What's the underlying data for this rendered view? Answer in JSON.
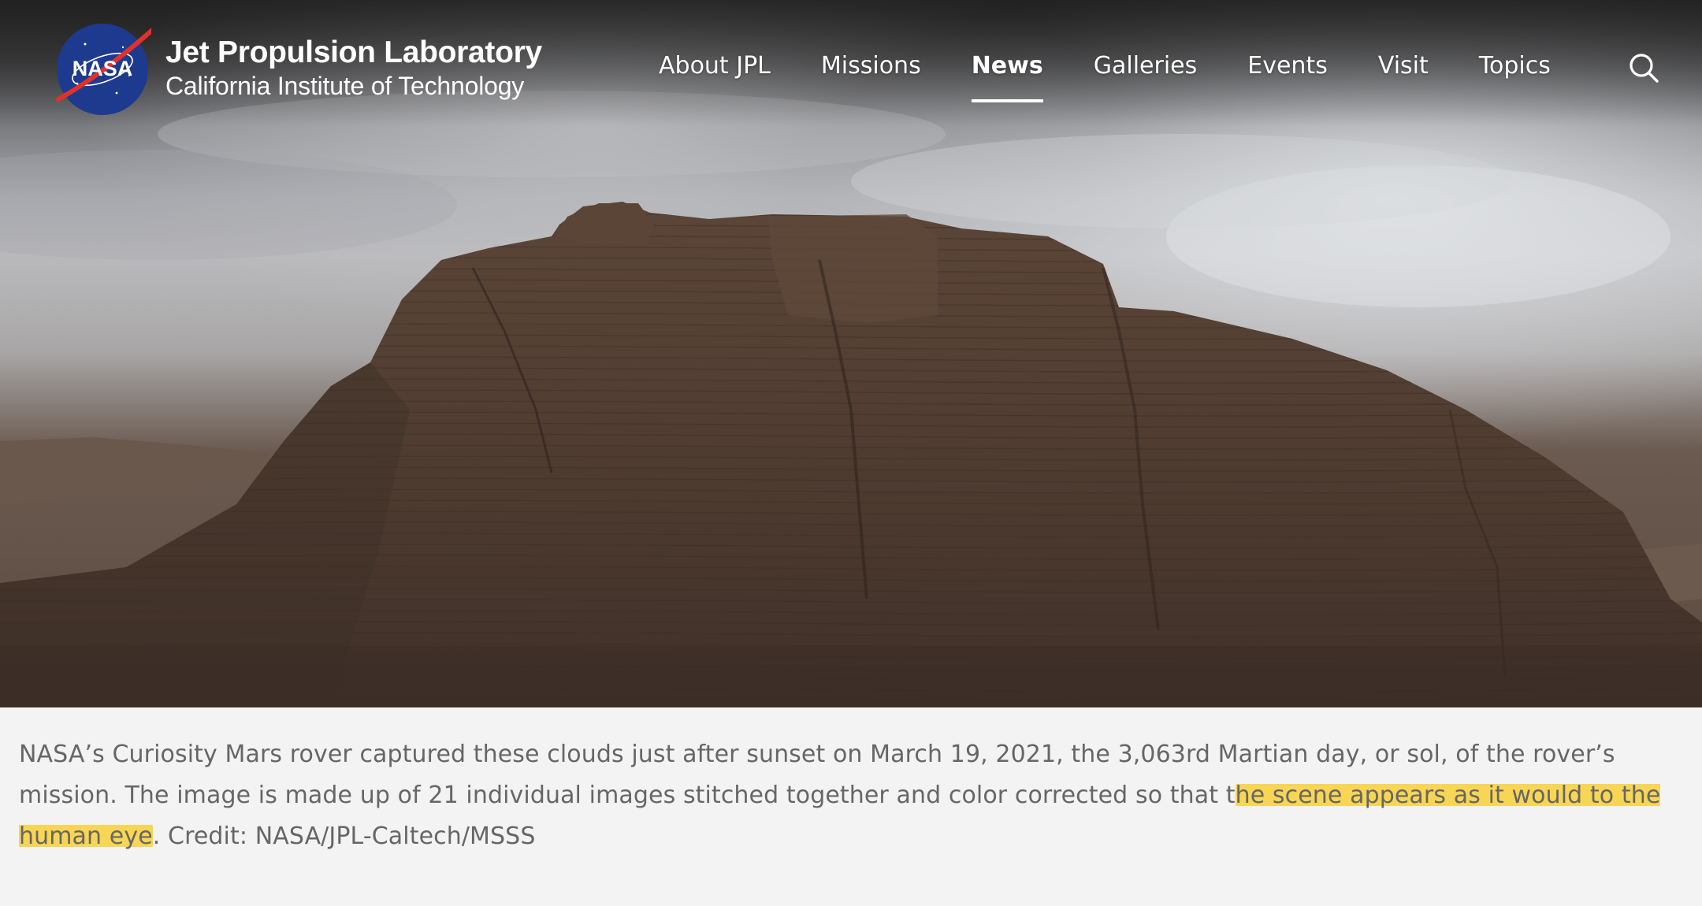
{
  "header": {
    "logo_text": "NASA",
    "brand_title": "Jet Propulsion Laboratory",
    "brand_subtitle": "California Institute of Technology",
    "nav": [
      {
        "label": "About JPL"
      },
      {
        "label": "Missions"
      },
      {
        "label": "News",
        "active": true
      },
      {
        "label": "Galleries"
      },
      {
        "label": "Events"
      },
      {
        "label": "Visit"
      },
      {
        "label": "Topics"
      }
    ],
    "search_icon": "search-icon"
  },
  "caption": {
    "text_before": "NASA’s Curiosity Mars rover captured these clouds just after sunset on March 19, 2021, the 3,063rd Martian day, or sol, of the rover’s mission. The image is made up of 21 individual images stitched together and color corrected so that t",
    "highlighted": "he scene appears as it would to the human eye",
    "text_after": ". Credit: NASA/JPL-Caltech/MSSS"
  },
  "colors": {
    "highlight": "#facd28",
    "caption_text": "#666666",
    "caption_bg": "#f3f3f3",
    "nav_text": "#ffffff"
  }
}
